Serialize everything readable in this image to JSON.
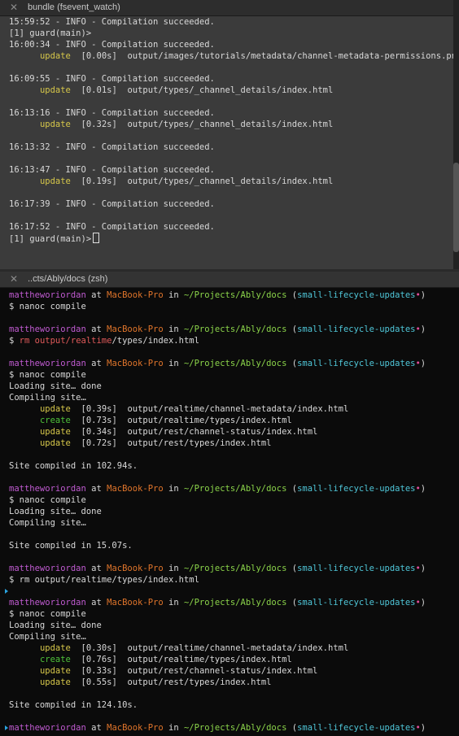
{
  "top_pane": {
    "tab_title": "bundle (fsevent_watch)",
    "close_glyph": "✕",
    "lines": [
      {
        "time": "15:59:52",
        "msg": " - INFO - Compilation succeeded."
      },
      {
        "text": "[1] guard(main)>"
      },
      {
        "time": "16:00:34",
        "msg": " - INFO - Compilation succeeded."
      },
      {
        "action": "update",
        "dur": "[0.00s]",
        "path": "output/images/tutorials/metadata/channel-metadata-permissions.png"
      },
      {
        "text": ""
      },
      {
        "time": "16:09:55",
        "msg": " - INFO - Compilation succeeded."
      },
      {
        "action": "update",
        "dur": "[0.01s]",
        "path": "output/types/_channel_details/index.html"
      },
      {
        "text": ""
      },
      {
        "time": "16:13:16",
        "msg": " - INFO - Compilation succeeded."
      },
      {
        "action": "update",
        "dur": "[0.32s]",
        "path": "output/types/_channel_details/index.html"
      },
      {
        "text": ""
      },
      {
        "time": "16:13:32",
        "msg": " - INFO - Compilation succeeded."
      },
      {
        "text": ""
      },
      {
        "time": "16:13:47",
        "msg": " - INFO - Compilation succeeded."
      },
      {
        "action": "update",
        "dur": "[0.19s]",
        "path": "output/types/_channel_details/index.html"
      },
      {
        "text": ""
      },
      {
        "time": "16:17:39",
        "msg": " - INFO - Compilation succeeded."
      },
      {
        "text": ""
      },
      {
        "time": "16:17:52",
        "msg": " - INFO - Compilation succeeded."
      },
      {
        "text": "[1] guard(main)>",
        "cursor": true
      }
    ]
  },
  "bottom_pane": {
    "tab_title": "..cts/Ably/docs (zsh)",
    "close_glyph": "✕",
    "prompt": {
      "user": "mattheworiordan",
      "at": " at ",
      "host": "MacBook-Pro",
      "in": " in ",
      "path": "~/Projects/Ably/docs",
      "branch": "small-lifecycle-updates",
      "dirty": "•"
    },
    "lines": [
      {
        "prompt": true
      },
      {
        "text": "$ nanoc compile"
      },
      {
        "text": ""
      },
      {
        "prompt": true
      },
      {
        "cmd_red": true,
        "pre": "$ ",
        "red": "rm output/realtime",
        "post": "/types/index.html"
      },
      {
        "text": ""
      },
      {
        "prompt": true
      },
      {
        "text": "$ nanoc compile"
      },
      {
        "text": "Loading site… done"
      },
      {
        "text": "Compiling site…"
      },
      {
        "action": "update",
        "dur": "[0.39s]",
        "path": "output/realtime/channel-metadata/index.html"
      },
      {
        "action": "create",
        "dur": "[0.73s]",
        "path": "output/realtime/types/index.html"
      },
      {
        "action": "update",
        "dur": "[0.34s]",
        "path": "output/rest/channel-status/index.html"
      },
      {
        "action": "update",
        "dur": "[0.72s]",
        "path": "output/rest/types/index.html"
      },
      {
        "text": ""
      },
      {
        "text": "Site compiled in 102.94s."
      },
      {
        "text": ""
      },
      {
        "prompt": true
      },
      {
        "text": "$ nanoc compile"
      },
      {
        "text": "Loading site… done"
      },
      {
        "text": "Compiling site…"
      },
      {
        "text": ""
      },
      {
        "text": "Site compiled in 15.07s."
      },
      {
        "text": ""
      },
      {
        "prompt": true
      },
      {
        "text": "$ rm output/realtime/types/index.html"
      },
      {
        "text": ""
      },
      {
        "prompt": true
      },
      {
        "text": "$ nanoc compile"
      },
      {
        "text": "Loading site… done"
      },
      {
        "text": "Compiling site…"
      },
      {
        "action": "update",
        "dur": "[0.30s]",
        "path": "output/realtime/channel-metadata/index.html"
      },
      {
        "action": "create",
        "dur": "[0.76s]",
        "path": "output/realtime/types/index.html"
      },
      {
        "action": "update",
        "dur": "[0.33s]",
        "path": "output/rest/channel-status/index.html"
      },
      {
        "action": "update",
        "dur": "[0.55s]",
        "path": "output/rest/types/index.html"
      },
      {
        "text": ""
      },
      {
        "text": "Site compiled in 124.10s."
      },
      {
        "text": ""
      },
      {
        "prompt": true
      }
    ]
  },
  "colors": {
    "update": "#d6c74a",
    "create": "#4fc23a",
    "user": "#c05bd1",
    "host": "#e0752b",
    "path": "#8bd44a",
    "branch": "#4fc6d8",
    "dirty": "#e04d9a",
    "marker": "#2aa4e0"
  }
}
